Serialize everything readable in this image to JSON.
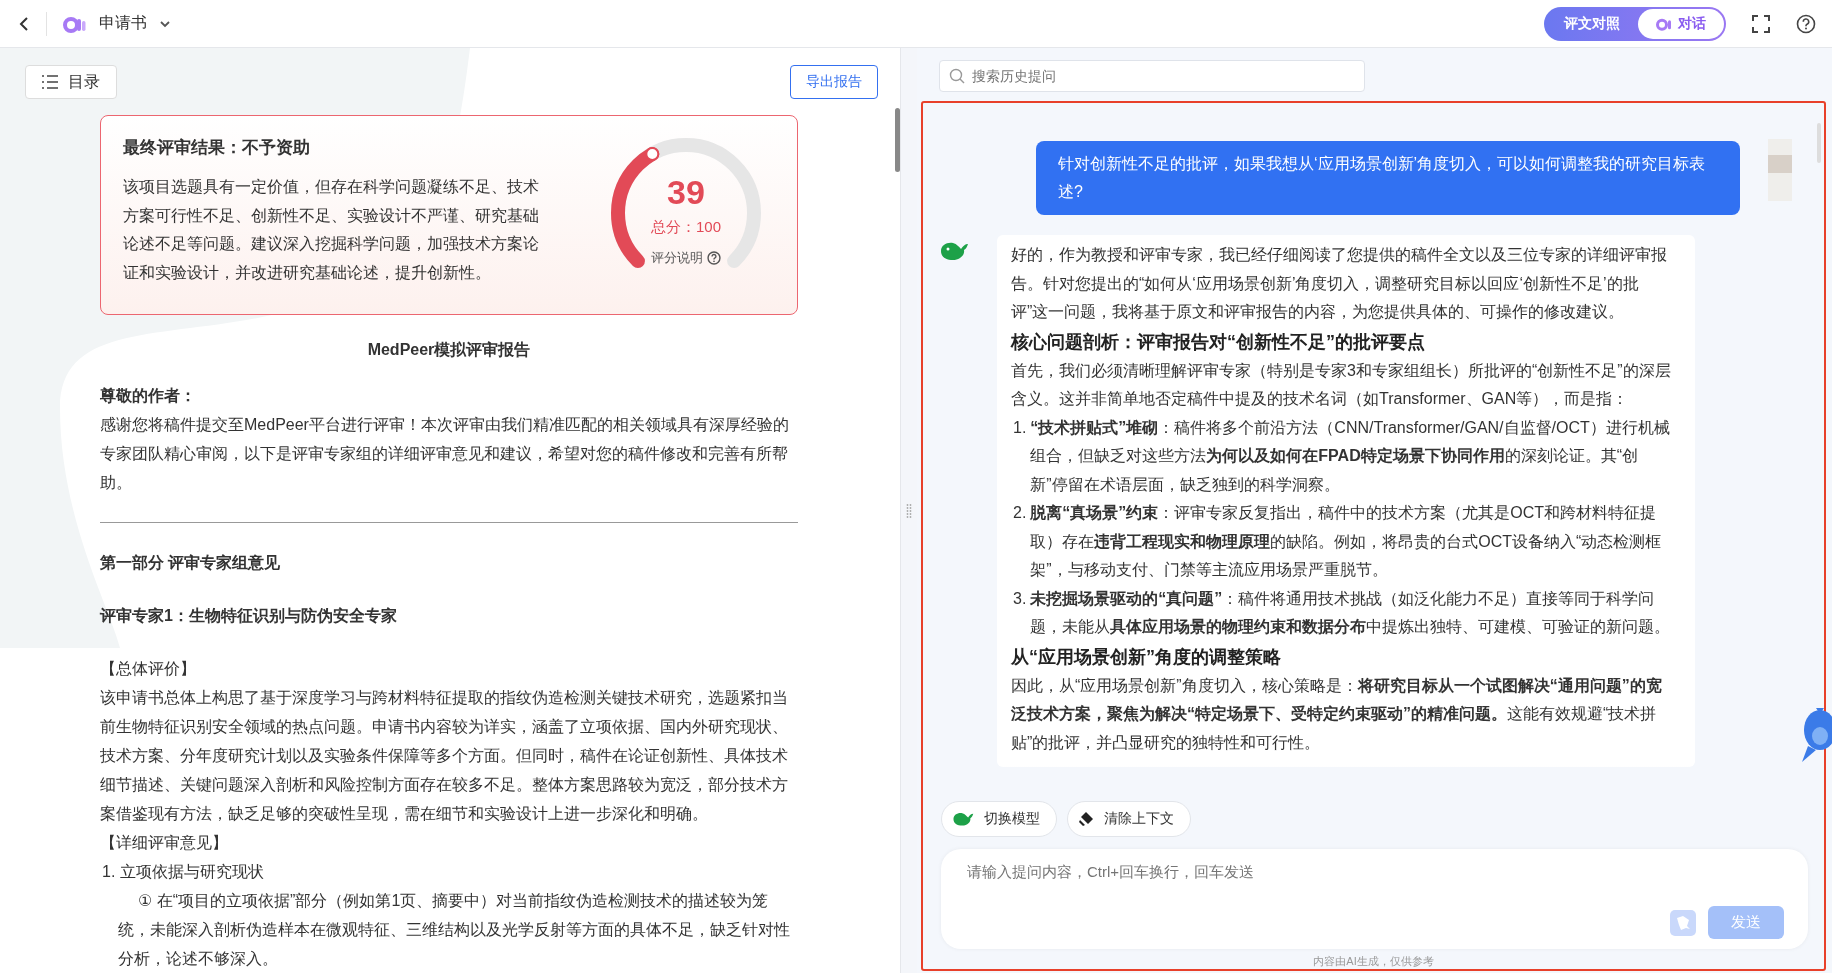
{
  "topbar": {
    "title": "申请书",
    "view_toggle": [
      {
        "label": "评文对照",
        "selected": false,
        "kind": "compare"
      },
      {
        "label": "对话",
        "selected": true,
        "kind": "chat"
      }
    ]
  },
  "report_panel": {
    "toc_button": "目录",
    "export_button": "导出报告",
    "result": {
      "title": "最终评审结果：不予资助",
      "summary": "该项目选题具有一定价值，但存在科学问题凝练不足、技术方案可行性不足、创新性不足、实验设计不严谨、研究基础论述不足等问题。建议深入挖掘科学问题，加强技术方案论证和实验设计，并改进研究基础论述，提升创新性。",
      "score": "39",
      "total": "总分：100",
      "note": "评分说明"
    },
    "blocks": [
      {
        "kind": "title",
        "text": "MedPeer模拟评审报告"
      },
      {
        "kind": "bold",
        "text": "尊敬的作者："
      },
      {
        "kind": "para",
        "text": "感谢您将稿件提交至MedPeer平台进行评审！本次评审由我们精准匹配的相关领域具有深厚经验的专家团队精心审阅，以下是评审专家组的详细评审意见和建议，希望对您的稿件修改和完善有所帮助。"
      },
      {
        "kind": "rule"
      },
      {
        "kind": "heading",
        "text": "第一部分 评审专家组意见"
      },
      {
        "kind": "heading",
        "text": "评审专家1：生物特征识别与防伪安全专家"
      },
      {
        "kind": "para",
        "text": "【总体评价】"
      },
      {
        "kind": "para",
        "text": "该申请书总体上构思了基于深度学习与跨材料特征提取的指纹伪造检测关键技术研究，选题紧扣当前生物特征识别安全领域的热点问题。申请书内容较为详实，涵盖了立项依据、国内外研究现状、技术方案、分年度研究计划以及实验条件保障等多个方面。但同时，稿件在论证创新性、具体技术细节描述、关键问题深入剖析和风险控制方面存在较多不足。整体方案思路较为宽泛，部分技术方案借鉴现有方法，缺乏足够的突破性呈现，需在细节和实验设计上进一步深化和明确。"
      },
      {
        "kind": "para",
        "text": "【详细评审意见】"
      },
      {
        "kind": "item",
        "text": "1. 立项依据与研究现状"
      },
      {
        "kind": "sub",
        "text": "① 在“项目的立项依据”部分（例如第1页、摘要中）对当前指纹伪造检测技术的描述较为笼统，未能深入剖析伪造样本在微观特征、三维结构以及光学反射等方面的具体不足，缺乏针对性分析，论述不够深入。"
      }
    ]
  },
  "chat_panel": {
    "search": {
      "placeholder": "搜索历史提问"
    },
    "messages": [
      {
        "kind": "user",
        "text": "针对创新性不足的批评，如果我想从‘应用场景创新’角度切入，可以如何调整我的研究目标表述?"
      },
      {
        "kind": "assistant",
        "blocks": [
          {
            "kind": "para",
            "text": "好的，作为教授和评审专家，我已经仔细阅读了您提供的稿件全文以及三位专家的详细评审报告。针对您提出的“如何从‘应用场景创新’角度切入，调整研究目标以回应‘创新性不足’的批评”这一问题，我将基于原文和评审报告的内容，为您提供具体的、可操作的修改建议。"
          },
          {
            "kind": "heading",
            "text": "核心问题剖析：评审报告对“创新性不足”的批评要点"
          },
          {
            "kind": "para",
            "text": "首先，我们必须清晰理解评审专家（特别是专家3和专家组组长）所批评的“创新性不足”的深层含义。这并非简单地否定稿件中提及的技术名词（如Transformer、GAN等），而是指："
          },
          {
            "kind": "item",
            "marker": "1.",
            "text": "**“技术拼贴式”堆砌**：稿件将多个前沿方法（CNN/Transformer/GAN/自监督/OCT）进行机械组合，但缺乏对这些方法**为何以及如何在FPAD特定场景下协同作用**的深刻论证。其“创新”停留在术语层面，缺乏独到的科学洞察。"
          },
          {
            "kind": "item",
            "marker": "2.",
            "text": "**脱离“真场景”约束**：评审专家反复指出，稿件中的技术方案（尤其是OCT和跨材料特征提取）存在**违背工程现实和物理原理**的缺陷。例如，将昂贵的台式OCT设备纳入“动态检测框架”，与移动支付、门禁等主流应用场景严重脱节。"
          },
          {
            "kind": "item",
            "marker": "3.",
            "text": "**未挖掘场景驱动的“真问题”**：稿件将通用技术挑战（如泛化能力不足）直接等同于科学问题，未能从**具体应用场景的物理约束和数据分布**中提炼出独特、可建模、可验证的新问题。"
          },
          {
            "kind": "heading",
            "text": "从“应用场景创新”角度的调整策略"
          },
          {
            "kind": "para",
            "text": "因此，从“应用场景创新”角度切入，核心策略是：**将研究目标从一个试图解决“通用问题”的宽泛技术方案，聚焦为解决“特定场景下、受特定约束驱动”的精准问题。**这能有效规避“技术拼贴”的批评，并凸显研究的独特性和可行性。"
          }
        ]
      }
    ],
    "tools": [
      {
        "kind": "model",
        "label": "切换模型"
      },
      {
        "kind": "clear",
        "label": "清除上下文"
      }
    ],
    "input": {
      "placeholder": "请输入提问内容，Ctrl+回车换行，回车发送"
    },
    "send_button": {
      "label": "发送",
      "disabled": true
    },
    "footer": "内容由AI生成，仅供参考"
  }
}
